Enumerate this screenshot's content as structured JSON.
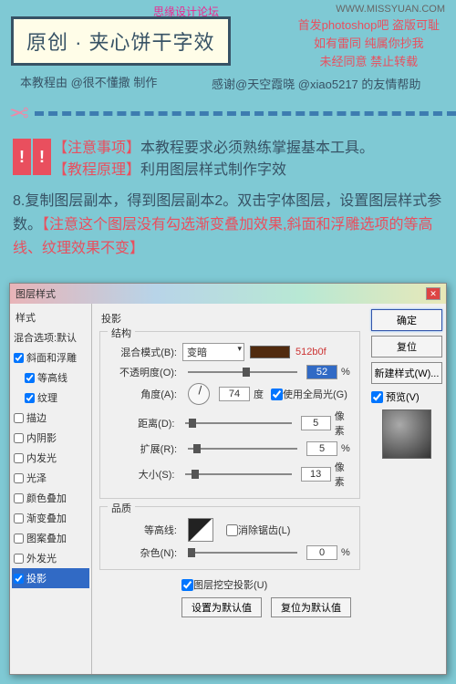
{
  "watermark1": "思缘设计论坛",
  "watermark2": "WWW.MISSYUAN.COM",
  "red_top1": "首发photoshop吧  盗版可耻",
  "red_top2": "如有雷同 纯属你抄我",
  "red_top3": "未经同意 禁止转载",
  "title": "原创 · 夹心饼干字效",
  "credit1": "本教程由 @很不懂撒 制作",
  "credit2": "感谢@天空霞晓 @xiao5217 的友情帮助",
  "alert1_red": "【注意事项】",
  "alert1": "本教程要求必须熟练掌握基本工具。",
  "alert2_red": "【教程原理】",
  "alert2": "利用图层样式制作字效",
  "step_a": "8.复制图层副本，得到图层副本2。双击字体图层，设置图层样式参数。",
  "step_red": "【注意这个图层没有勾选渐变叠加效果,斜面和浮雕选项的等高线、纹理效果不变】",
  "dialog": {
    "title": "图层样式",
    "sidebar_head": "样式",
    "sidebar": [
      {
        "label": "混合选项:默认",
        "checked": false,
        "nochk": true
      },
      {
        "label": "斜面和浮雕",
        "checked": true
      },
      {
        "label": "等高线",
        "checked": true,
        "indent": true
      },
      {
        "label": "纹理",
        "checked": true,
        "indent": true
      },
      {
        "label": "描边",
        "checked": false
      },
      {
        "label": "内阴影",
        "checked": false
      },
      {
        "label": "内发光",
        "checked": false
      },
      {
        "label": "光泽",
        "checked": false
      },
      {
        "label": "颜色叠加",
        "checked": false
      },
      {
        "label": "渐变叠加",
        "checked": false
      },
      {
        "label": "图案叠加",
        "checked": false
      },
      {
        "label": "外发光",
        "checked": false
      },
      {
        "label": "投影",
        "checked": true,
        "selected": true
      }
    ],
    "panel_title": "投影",
    "group1": "结构",
    "blend_label": "混合模式(B):",
    "blend_value": "变暗",
    "color_hex": "512b0f",
    "opacity_label": "不透明度(O):",
    "opacity_value": "52",
    "angle_label": "角度(A):",
    "angle_value": "74",
    "angle_unit": "度",
    "global_light": "使用全局光(G)",
    "distance_label": "距离(D):",
    "distance_value": "5",
    "px": "像素",
    "spread_label": "扩展(R):",
    "spread_value": "5",
    "pct": "%",
    "size_label": "大小(S):",
    "size_value": "13",
    "group2": "品质",
    "contour_label": "等高线:",
    "antialias": "消除锯齿(L)",
    "noise_label": "杂色(N):",
    "noise_value": "0",
    "knockout": "图层挖空投影(U)",
    "btn_default": "设置为默认值",
    "btn_reset": "复位为默认值",
    "btn_ok": "确定",
    "btn_cancel": "复位",
    "btn_new": "新建样式(W)...",
    "preview": "预览(V)"
  }
}
